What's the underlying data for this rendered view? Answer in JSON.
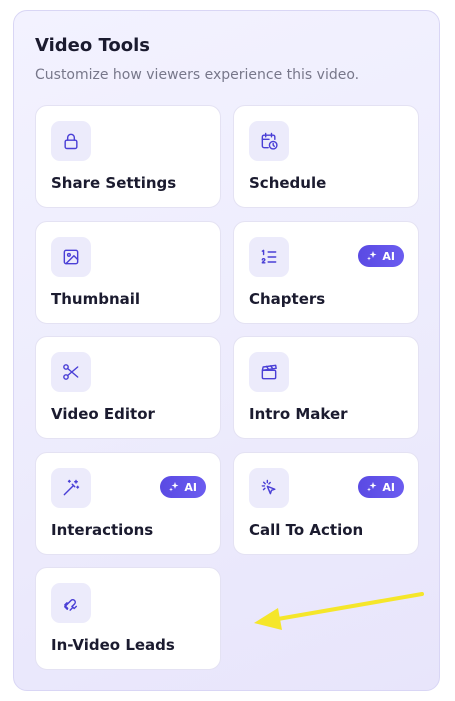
{
  "panel": {
    "title": "Video Tools",
    "subtitle": "Customize how viewers experience this video."
  },
  "tools": [
    {
      "label": "Share Settings",
      "icon": "lock-icon",
      "ai": false
    },
    {
      "label": "Schedule",
      "icon": "calendar-clock-icon",
      "ai": false
    },
    {
      "label": "Thumbnail",
      "icon": "image-icon",
      "ai": false
    },
    {
      "label": "Chapters",
      "icon": "numbered-list-icon",
      "ai": true
    },
    {
      "label": "Video Editor",
      "icon": "scissors-icon",
      "ai": false
    },
    {
      "label": "Intro Maker",
      "icon": "clapperboard-icon",
      "ai": false
    },
    {
      "label": "Interactions",
      "icon": "magic-wand-icon",
      "ai": true
    },
    {
      "label": "Call To Action",
      "icon": "cursor-click-icon",
      "ai": true
    },
    {
      "label": "In-Video Leads",
      "icon": "magnet-icon",
      "ai": false
    }
  ],
  "badge": {
    "label": "AI"
  },
  "colors": {
    "accent": "#4a3fd6",
    "badge": "#5a4ae3",
    "arrow": "#f5e62a",
    "panel_bg": "#efeefd"
  }
}
